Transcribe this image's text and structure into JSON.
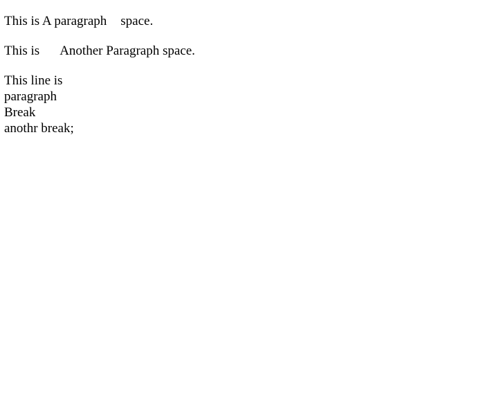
{
  "paragraphs": [
    {
      "before": "This is A paragraph",
      "after": "space."
    },
    {
      "before": "This is",
      "after": "Another Paragraph space."
    }
  ],
  "break_block": {
    "lines": [
      "This line is",
      "paragraph",
      "Break",
      "anothr break;"
    ]
  }
}
